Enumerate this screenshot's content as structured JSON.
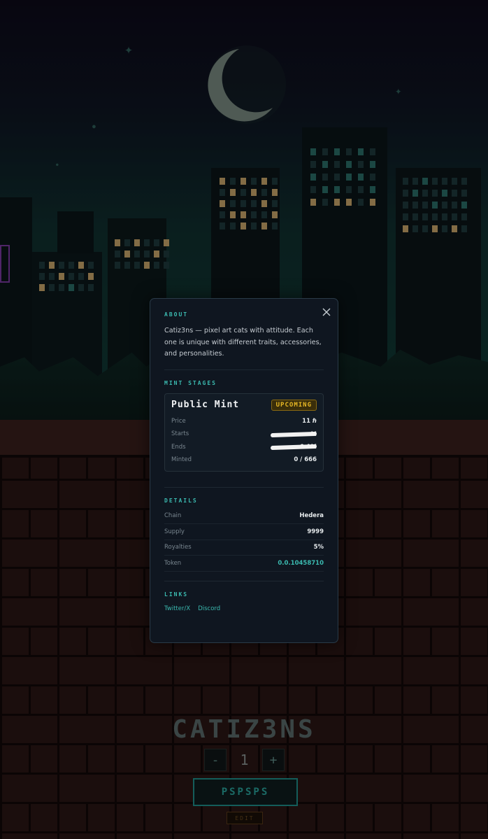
{
  "background": {
    "collection_title": "CATIZ3NS",
    "quantity": "1",
    "minus_label": "-",
    "plus_label": "+",
    "mint_button_label": "PSPSPS",
    "edit_label": "EDIT"
  },
  "modal": {
    "close_icon": "close-icon",
    "about": {
      "heading": "ABOUT",
      "text": "Catiz3ns — pixel art cats with attitude. Each one is unique with different traits, accessories, and personalities."
    },
    "mint_stages": {
      "heading": "MINT STAGES",
      "stages": [
        {
          "name": "Public Mint",
          "status": "UPCOMING",
          "rows": [
            {
              "label": "Price",
              "value": "11 ℏ"
            },
            {
              "label": "Starts",
              "value": "M",
              "value_suffix": "M",
              "redacted": true
            },
            {
              "label": "Ends",
              "value": "M",
              "value_suffix": "0 AM",
              "redacted": true
            },
            {
              "label": "Minted",
              "value": "0 / 666"
            }
          ]
        }
      ]
    },
    "details": {
      "heading": "DETAILS",
      "rows": [
        {
          "label": "Chain",
          "value": "Hedera"
        },
        {
          "label": "Supply",
          "value": "9999"
        },
        {
          "label": "Royalties",
          "value": "5%"
        },
        {
          "label": "Token",
          "value": "0.0.10458710"
        }
      ]
    },
    "links": {
      "heading": "LINKS",
      "items": [
        "Twitter/X",
        "Discord"
      ]
    }
  },
  "colors": {
    "accent": "#3bbab0",
    "badge": "#e8b824",
    "modal_bg": "#0f1620"
  }
}
